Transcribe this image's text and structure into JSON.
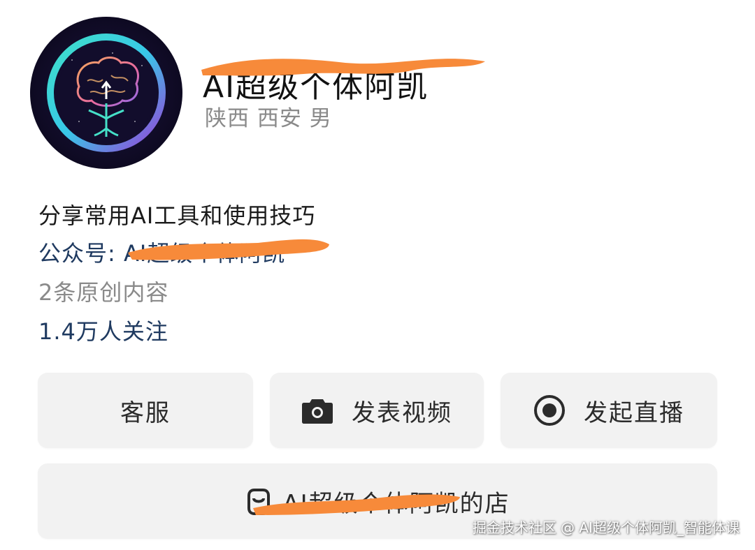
{
  "profile": {
    "name": "AI超级个体阿凯",
    "location": "陕西 西安 男",
    "bio": "分享常用AI工具和使用技巧",
    "official_account": "公众号: AI超级个体阿凯",
    "original_count": "2条原创内容",
    "followers": "1.4万人关注"
  },
  "actions": {
    "service_label": "客服",
    "video_label": "发表视频",
    "live_label": "发起直播",
    "shop_label": "AI超级个体阿凯的店"
  },
  "icons": {
    "avatar": "brain-tree-logo",
    "video": "camera-icon",
    "live": "record-icon",
    "shop": "shop-icon"
  },
  "watermark": "掘金技术社区 @ AI超级个体阿凯_智能体课",
  "colors": {
    "link_blue": "#1f3a60",
    "muted_gray": "#8a8a8a",
    "button_bg": "#f2f2f2",
    "redaction_orange": "#f78a3a"
  }
}
